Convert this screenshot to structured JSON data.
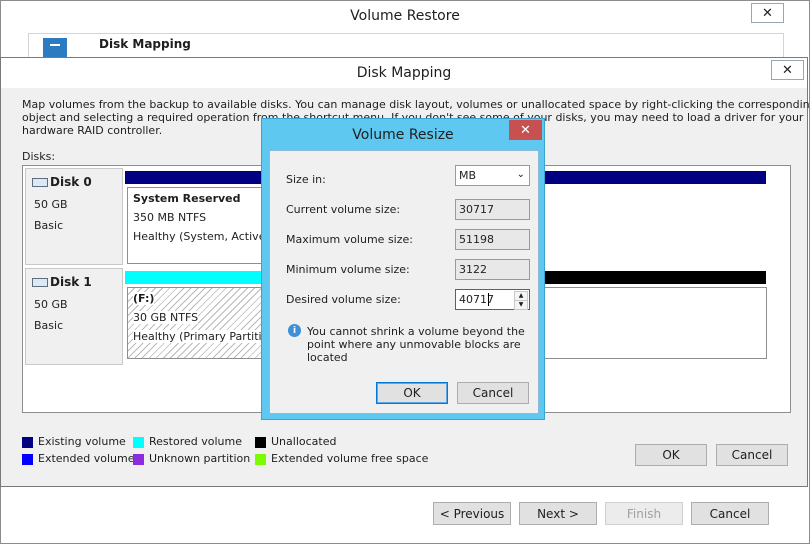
{
  "restore_window": {
    "title": "Volume Restore",
    "step_title": "Disk Mapping",
    "buttons": {
      "previous": "< Previous",
      "next": "Next >",
      "finish": "Finish",
      "cancel": "Cancel"
    }
  },
  "mapping_dialog": {
    "title": "Disk Mapping",
    "description_l1": "Map volumes from the backup to available disks. You can manage disk layout, volumes or unallocated space by right-clicking the corresponding",
    "description_l2": "object and selecting a required operation from the shortcut menu. If you don't see some of your disks, you may need to load a driver for your",
    "description_l3": "hardware RAID controller.",
    "disks_label": "Disks:",
    "disks": [
      {
        "name": "Disk 0",
        "size": "50 GB",
        "type": "Basic",
        "volume": {
          "name": "System Reserved",
          "size_fs": "350 MB NTFS",
          "status": "Healthy (System, Active,"
        }
      },
      {
        "name": "Disk 1",
        "size": "50 GB",
        "type": "Basic",
        "volume": {
          "name": "(F:)",
          "size_fs": "30 GB NTFS",
          "status": "Healthy (Primary Partitio"
        }
      }
    ],
    "legend": [
      {
        "label": "Existing volume",
        "color": "#000080"
      },
      {
        "label": "Restored volume",
        "color": "#00ffff"
      },
      {
        "label": "Unallocated",
        "color": "#000000"
      },
      {
        "label": "Extended volume",
        "color": "#0000ff"
      },
      {
        "label": "Unknown partition",
        "color": "#8b2be2"
      },
      {
        "label": "Extended volume free space",
        "color": "#7cfc00"
      }
    ],
    "buttons": {
      "ok": "OK",
      "cancel": "Cancel"
    }
  },
  "resize_dialog": {
    "title": "Volume Resize",
    "size_in_label": "Size in:",
    "size_in_value": "MB",
    "current_label": "Current volume size:",
    "current_value": "30717",
    "maximum_label": "Maximum volume size:",
    "maximum_value": "51198",
    "minimum_label": "Minimum volume size:",
    "minimum_value": "3122",
    "desired_label": "Desired volume size:",
    "desired_value": "40717",
    "info_l1": "You cannot shrink a volume beyond the",
    "info_l2": "point where any unmovable blocks are",
    "info_l3": "located",
    "buttons": {
      "ok": "OK",
      "cancel": "Cancel"
    }
  }
}
